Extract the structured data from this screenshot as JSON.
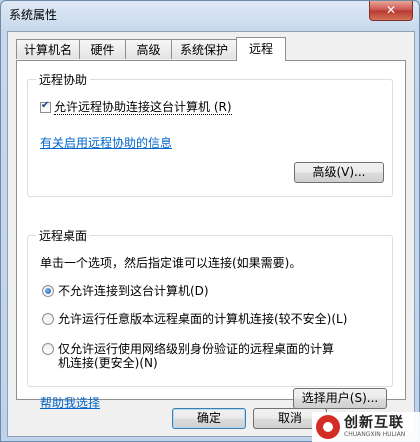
{
  "window": {
    "title": "系统属性",
    "close_glyph": "✕"
  },
  "tabs": [
    {
      "label": "计算机名"
    },
    {
      "label": "硬件"
    },
    {
      "label": "高级"
    },
    {
      "label": "系统保护"
    },
    {
      "label": "远程"
    }
  ],
  "remote_assistance": {
    "group_label": "远程协助",
    "allow_checkbox": {
      "label": "允许远程协助连接这台计算机 (R)",
      "checked": true
    },
    "info_link": "有关启用远程协助的信息",
    "advanced_button": "高级(V)..."
  },
  "remote_desktop": {
    "group_label": "远程桌面",
    "instruction": "单击一个选项，然后指定谁可以连接(如果需要)。",
    "options": [
      {
        "label": "不允许连接到这台计算机(D)",
        "checked": true
      },
      {
        "label": "允许运行任意版本远程桌面的计算机连接(较不安全)(L)",
        "checked": false
      },
      {
        "label_line1": "仅允许运行使用网络级别身份验证的远程桌面的计算",
        "label_line2": "机连接(更安全)(N)",
        "checked": false
      }
    ],
    "help_link": "帮助我选择",
    "select_users_button": "选择用户(S)..."
  },
  "footer": {
    "ok_button": "确定",
    "cancel_button": "取消"
  },
  "watermark": {
    "brand": "创新互联",
    "sub": "CHUANGXIN HULIAN"
  }
}
